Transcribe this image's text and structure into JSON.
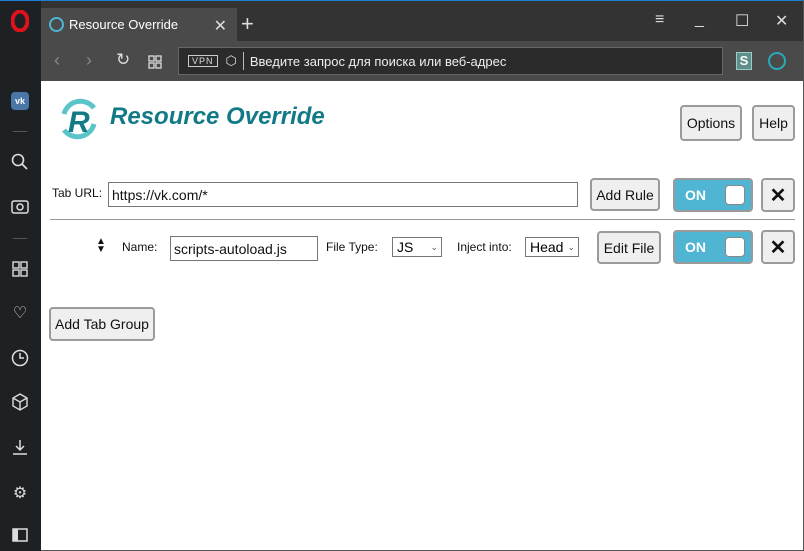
{
  "browser": {
    "tab_title": "Resource Override",
    "address_placeholder": "Введите запрос для поиска или веб-адрес",
    "vpn_label": "VPN"
  },
  "sidebar": {
    "items": [
      "opera-logo",
      "vk",
      "search",
      "camera",
      "speed-dial",
      "bookmarks",
      "history",
      "extensions",
      "downloads",
      "settings",
      "sidebar-toggle"
    ]
  },
  "page": {
    "title": "Resource Override",
    "options_label": "Options",
    "help_label": "Help",
    "add_tab_group_label": "Add Tab Group"
  },
  "tab_group": {
    "tab_url_label": "Tab URL:",
    "tab_url_value": "https://vk.com/*",
    "add_rule_label": "Add Rule",
    "toggle_label": "ON",
    "close_label": "✕"
  },
  "rule": {
    "name_label": "Name:",
    "name_value": "scripts-autoload.js",
    "file_type_label": "File Type:",
    "file_type_value": "JS",
    "inject_label": "Inject into:",
    "inject_value": "Head",
    "edit_file_label": "Edit File",
    "toggle_label": "ON",
    "close_label": "✕"
  },
  "colors": {
    "accent": "#4fb5d2",
    "title": "#127a87",
    "opera_red": "#e0121d"
  }
}
